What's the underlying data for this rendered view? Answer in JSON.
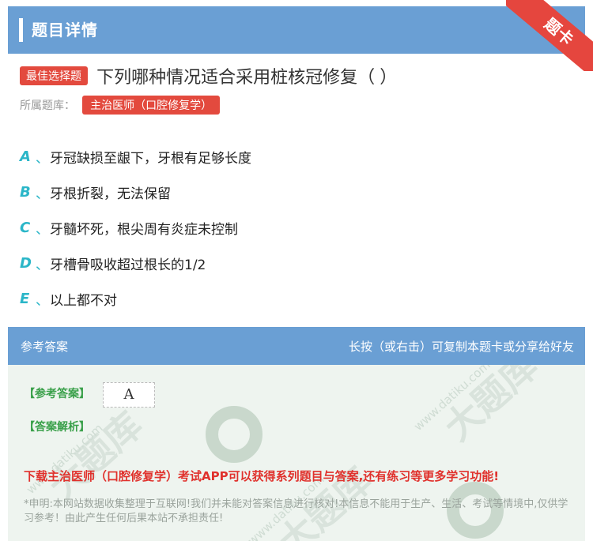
{
  "header": {
    "title": "题目详情",
    "corner": "题卡"
  },
  "question": {
    "badge": "最佳选择题",
    "text": "下列哪种情况适合采用桩核冠修复（ ）",
    "source_label": "所属题库：",
    "source_tag": "主治医师（口腔修复学）"
  },
  "options": [
    {
      "letter": "A",
      "sep": "、",
      "text": "牙冠缺损至龈下，牙根有足够长度"
    },
    {
      "letter": "B",
      "sep": "、",
      "text": "牙根折裂，无法保留"
    },
    {
      "letter": "C",
      "sep": "、",
      "text": "牙髓坏死，根尖周有炎症未控制"
    },
    {
      "letter": "D",
      "sep": "、",
      "text": "牙槽骨吸收超过根长的1/2"
    },
    {
      "letter": "E",
      "sep": "、",
      "text": "以上都不对"
    }
  ],
  "answer": {
    "header_left": "参考答案",
    "header_right": "长按（或右击）可复制本题卡或分享给好友",
    "answer_label": "【参考答案】",
    "answer_value": "A",
    "analysis_label": "【答案解析】",
    "promo": "下载主治医师（口腔修复学）考试APP可以获得系列题目与答案,还有练习等更多学习功能!",
    "disclaimer": "*申明:本网站数据收集整理于互联网!我们并未能对答案信息进行核对!本信息不能用于生产、生活、考试等情境中,仅供学习参考！由此产生任何后果本站不承担责任!"
  },
  "watermark": {
    "brand": "大题库",
    "url": "www.datiku.com"
  },
  "colors": {
    "header_bg": "#6a9fd4",
    "badge_red": "#e34a3e",
    "option_letter": "#2bb6c8",
    "answer_green": "#3aa04a",
    "promo_red": "#e0312c"
  }
}
